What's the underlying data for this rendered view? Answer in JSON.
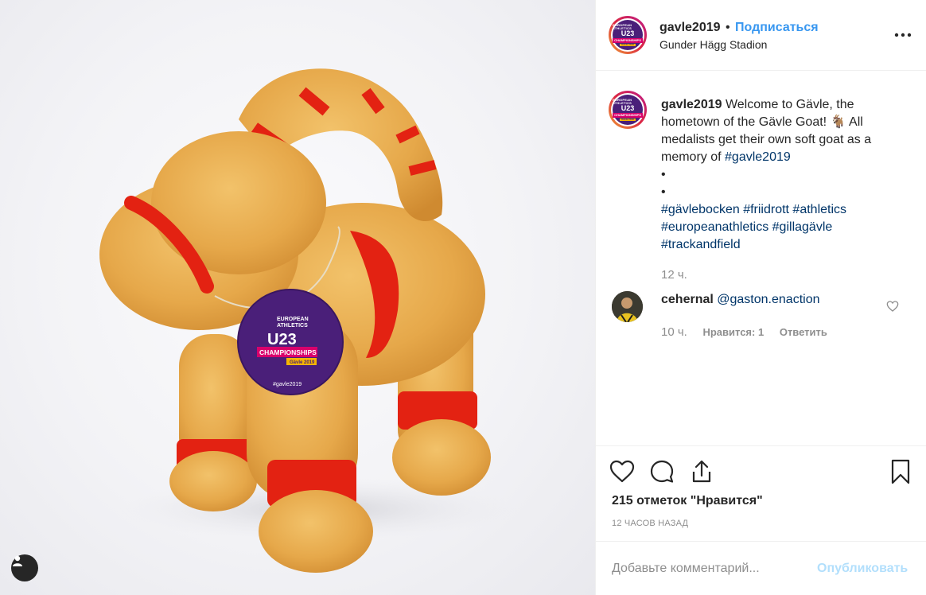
{
  "post": {
    "username": "gavle2019",
    "dot": "•",
    "follow_label": "Подписаться",
    "location": "Gunder Hägg Stadion",
    "more_icon": "more-dots-icon"
  },
  "avatar_logo": {
    "line1": "EUROPEAN ATHLETICS",
    "line2": "U23",
    "line3": "CHAMPIONSHIPS",
    "line4": "Gävle 2019"
  },
  "photo_tag": {
    "line1": "EUROPEAN",
    "line2": "ATHLETICS",
    "line3": "U23",
    "line4": "CHAMPIONSHIPS",
    "line5": "Gävle 2019",
    "hashtag": "#gavle2019"
  },
  "caption": {
    "username": "gavle2019",
    "text": "Welcome to Gävle, the hometown of the Gävle Goat! 🐐 All medalists get their own soft goat as a memory of",
    "tag1": "#gavle2019",
    "bullet1": "•",
    "bullet2": "•",
    "tags_line1": "#gävlebocken #friidrott #athletics",
    "tags_line2": "#europeanathletics #gillagävle",
    "tags_line3": "#trackandfield",
    "time": "12 ч."
  },
  "comment": {
    "username": "cehernal",
    "mention": "@gaston.enaction",
    "time": "10 ч.",
    "likes": "Нравится: 1",
    "reply": "Ответить"
  },
  "actions": {
    "likes_text": "215 отметок \"Нравится\"",
    "time_ago": "12 ЧАСОВ НАЗАД"
  },
  "add_comment": {
    "placeholder": "Добавьте комментарий...",
    "publish": "Опубликовать"
  },
  "colors": {
    "link": "#3897f0",
    "hashtag": "#003569",
    "muted": "#8e8e8e",
    "publish_disabled": "#b2dffc"
  }
}
